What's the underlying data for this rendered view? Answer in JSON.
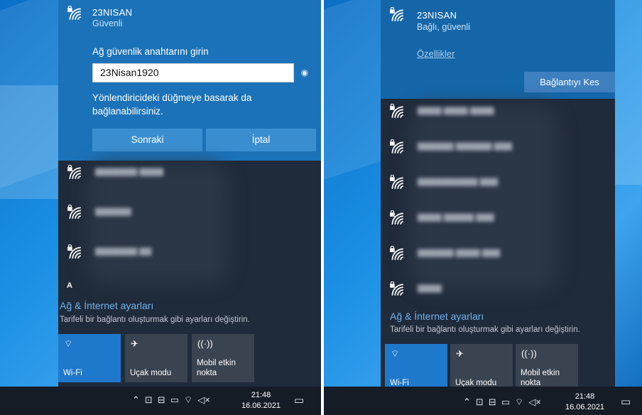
{
  "left": {
    "network": {
      "name": "23NISAN",
      "status": "Güvenli"
    },
    "prompt": "Ağ güvenlik anahtarını girin",
    "password_value": "23Nisan1920",
    "hint": "Yönlendiricideki düğmeye basarak da bağlanabilirsiniz.",
    "next_button": "Sonraki",
    "cancel_button": "İptal",
    "partial_row_label": "A",
    "settings_title": "Ağ & İnternet ayarları",
    "settings_subtitle": "Tarifeli bir bağlantı oluşturmak gibi ayarları değiştirin.",
    "tiles": [
      {
        "label": "Wi-Fi",
        "icon": "wifi-icon",
        "active": true
      },
      {
        "label": "Uçak modu",
        "icon": "airplane-icon",
        "active": false
      },
      {
        "label": "Mobil etkin nokta",
        "icon": "hotspot-icon",
        "active": false
      }
    ],
    "clock": {
      "time": "21:48",
      "date": "16.06.2021"
    }
  },
  "right": {
    "network": {
      "name": "23NISAN",
      "status": "Bağlı, güvenli"
    },
    "properties_link": "Özellikler",
    "disconnect_button": "Bağlantıyı Kes",
    "settings_title": "Ağ & İnternet ayarları",
    "settings_subtitle": "Tarifeli bir bağlantı oluşturmak gibi ayarları değiştirin.",
    "tiles": [
      {
        "label": "Wi-Fi",
        "icon": "wifi-icon",
        "active": true
      },
      {
        "label": "Uçak modu",
        "icon": "airplane-icon",
        "active": false
      },
      {
        "label": "Mobil etkin nokta",
        "icon": "hotspot-icon",
        "active": false
      }
    ],
    "clock": {
      "time": "21:48",
      "date": "16.06.2021"
    }
  },
  "tray_icons": [
    "chevron-up-icon",
    "people-icon",
    "network-icon",
    "battery-icon",
    "wifi-icon",
    "volume-muted-icon"
  ],
  "colors": {
    "accent": "#1e78cc",
    "flyout": "#1f2a3a",
    "active_card": "#1b72b8",
    "link": "#6fb3ef"
  }
}
